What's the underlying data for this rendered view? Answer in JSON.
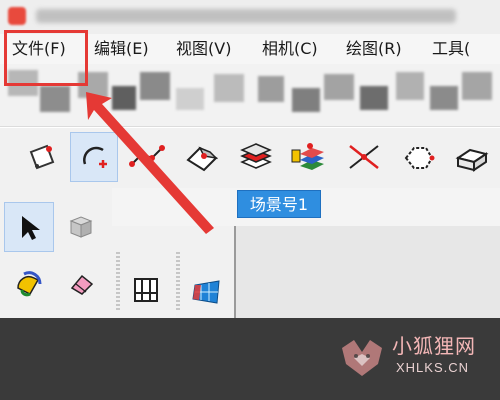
{
  "menu": {
    "items": [
      {
        "label": "文件(F)"
      },
      {
        "label": "编辑(E)"
      },
      {
        "label": "视图(V)"
      },
      {
        "label": "相机(C)"
      },
      {
        "label": "绘图(R)"
      },
      {
        "label": "工具("
      }
    ]
  },
  "toolbar": {
    "icons": [
      "make-component-icon",
      "arc-icon",
      "polyline-icon",
      "follow-me-icon",
      "layers-icon",
      "materials-icon",
      "section-plane-icon",
      "shape-icon",
      "push-pull-icon"
    ]
  },
  "scene": {
    "tab_label": "场景号1"
  },
  "watermark": {
    "name": "小狐狸网",
    "domain": "XHLKS.CN"
  },
  "colors": {
    "highlight": "#e53935",
    "scene_tab": "#2f8ee0",
    "dark": "#3a3a3a"
  }
}
